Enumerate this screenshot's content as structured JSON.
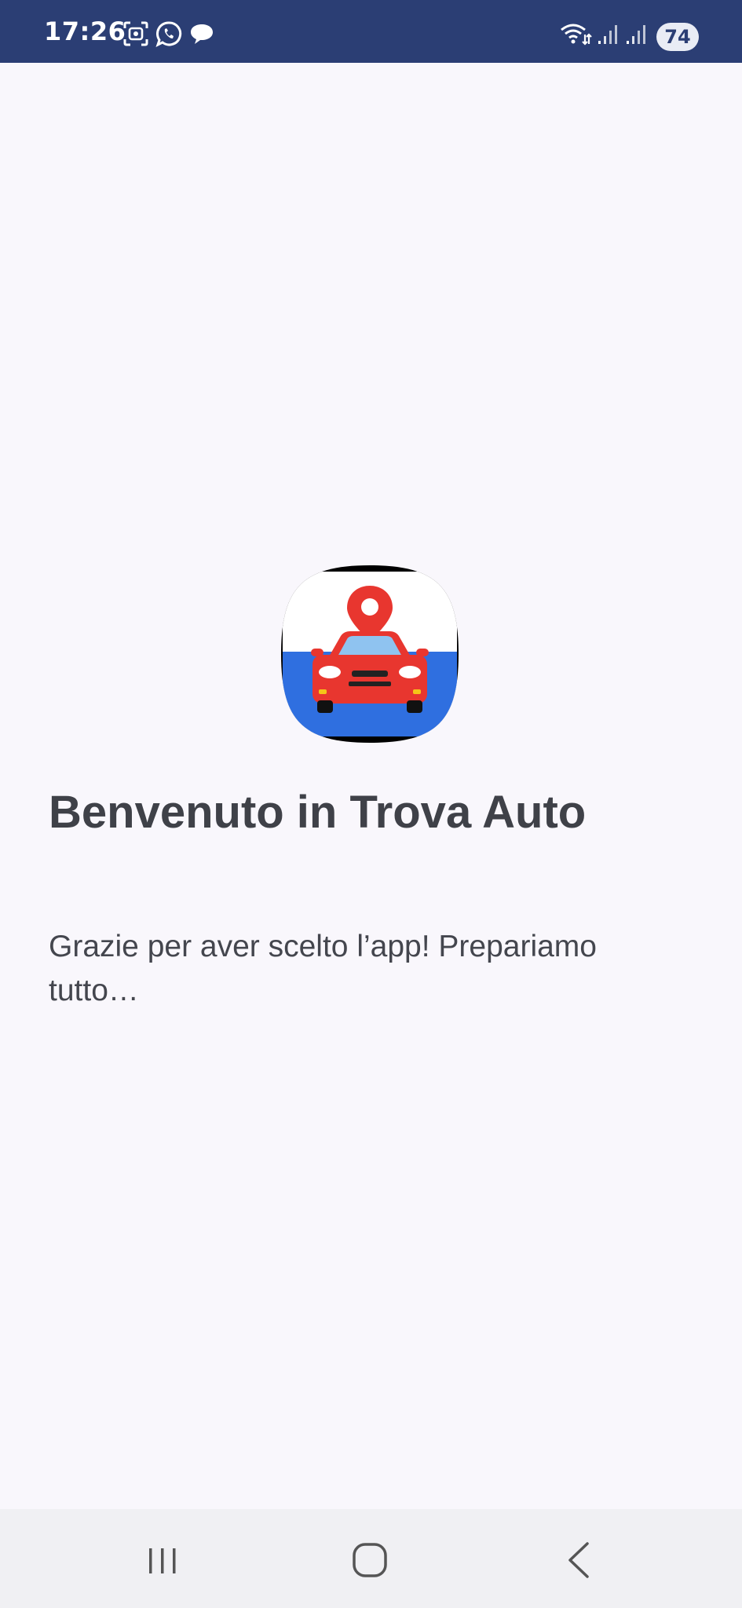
{
  "status_bar": {
    "time": "17:26",
    "battery_level": "74",
    "left_icons": [
      "screenshot-icon",
      "whatsapp-icon",
      "chat-bubble-icon"
    ],
    "right_icons": [
      "wifi-icon",
      "signal-icon",
      "signal-icon"
    ],
    "background_color": "#2b3e74"
  },
  "welcome": {
    "title": "Benvenuto in Trova Auto",
    "message": "Grazie per aver scelto l’app! Prepariamo tutto…"
  },
  "nav_bar": {
    "buttons": [
      "recent-apps-icon",
      "home-icon",
      "back-icon"
    ]
  },
  "colors": {
    "background": "#f9f7fc",
    "text": "#3f4148",
    "car_red": "#e8362f",
    "logo_blue": "#2f6fe0"
  }
}
